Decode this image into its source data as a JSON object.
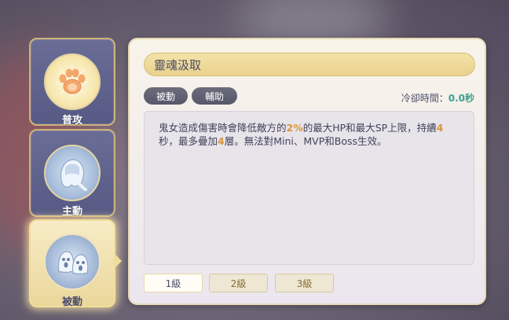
{
  "sidebar": {
    "tabs": [
      {
        "label": "普攻",
        "icon": "paw-icon"
      },
      {
        "label": "主動",
        "icon": "ghost-girl-icon"
      },
      {
        "label": "被動",
        "icon": "ghost-spirits-icon",
        "active": true
      }
    ]
  },
  "skill": {
    "name": "靈魂汲取",
    "tags": [
      "被動",
      "輔助"
    ],
    "cooldown_label": "冷卻時間：",
    "cooldown_value": "0.0秒",
    "desc_part1": "鬼女造成傷害時會降低敵方的",
    "desc_hl1": "2%",
    "desc_part2": "的最大HP和最大SP上限，持續",
    "desc_hl2": "4",
    "desc_part3": "秒，最多疊加",
    "desc_hl3": "4",
    "desc_part4": "層。無法對Mini、MVP和Boss生效。"
  },
  "levels": [
    "1級",
    "2級",
    "3級"
  ],
  "active_level": "1級",
  "colors": {
    "highlight": "#d9953a",
    "cooldown_value": "#3aa38e",
    "tab_bg": "#5e628c",
    "title_bar": "#f0dc9c"
  }
}
